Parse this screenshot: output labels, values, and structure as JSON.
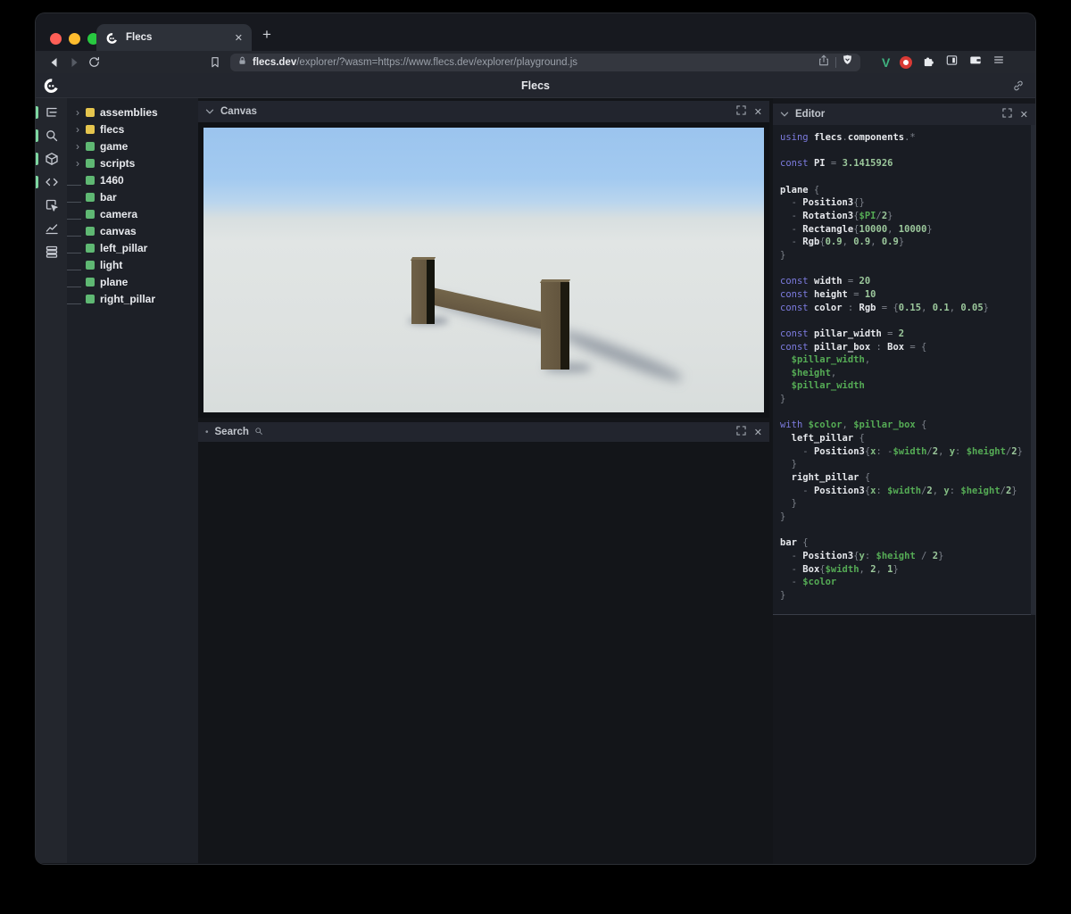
{
  "browser": {
    "tab": {
      "label": "Flecs"
    },
    "new_tab_label": "+",
    "url_domain": "flecs.dev",
    "url_path": "/explorer/?wasm=https://www.flecs.dev/explorer/playground.js"
  },
  "header": {
    "title": "Flecs"
  },
  "rail": {
    "items": [
      "tree-view",
      "search",
      "entities",
      "code",
      "inspect",
      "chart",
      "stats"
    ],
    "active": [
      "tree-view",
      "search",
      "entities",
      "code"
    ]
  },
  "tree": {
    "items": [
      {
        "label": "assemblies",
        "color": "yellow",
        "expandable": true
      },
      {
        "label": "flecs",
        "color": "yellow",
        "expandable": true
      },
      {
        "label": "game",
        "color": "green",
        "expandable": true
      },
      {
        "label": "scripts",
        "color": "green",
        "expandable": true
      },
      {
        "label": "1460",
        "color": "green",
        "expandable": false
      },
      {
        "label": "bar",
        "color": "green",
        "expandable": false
      },
      {
        "label": "camera",
        "color": "green",
        "expandable": false
      },
      {
        "label": "canvas",
        "color": "green",
        "expandable": false
      },
      {
        "label": "left_pillar",
        "color": "green",
        "expandable": false
      },
      {
        "label": "light",
        "color": "green",
        "expandable": false
      },
      {
        "label": "plane",
        "color": "green",
        "expandable": false
      },
      {
        "label": "right_pillar",
        "color": "green",
        "expandable": false
      }
    ]
  },
  "panels": {
    "canvas": {
      "title": "Canvas"
    },
    "search": {
      "title": "Search"
    },
    "editor": {
      "title": "Editor"
    }
  },
  "editor": {
    "code_lines": [
      [
        [
          "k",
          "using "
        ],
        [
          "i",
          "flecs"
        ],
        [
          "p",
          "."
        ],
        [
          "i",
          "components"
        ],
        [
          "p",
          ".*"
        ]
      ],
      [],
      [
        [
          "k",
          "const "
        ],
        [
          "i",
          "PI"
        ],
        [
          "p",
          " = "
        ],
        [
          "n",
          "3.1415926"
        ]
      ],
      [],
      [
        [
          "i",
          "plane"
        ],
        [
          "p",
          " {"
        ]
      ],
      [
        [
          "p",
          "  - "
        ],
        [
          "i",
          "Position3"
        ],
        [
          "p",
          "{}"
        ]
      ],
      [
        [
          "p",
          "  - "
        ],
        [
          "i",
          "Rotation3"
        ],
        [
          "p",
          "{"
        ],
        [
          "v",
          "$PI"
        ],
        [
          "p",
          "/"
        ],
        [
          "n",
          "2"
        ],
        [
          "p",
          "}"
        ]
      ],
      [
        [
          "p",
          "  - "
        ],
        [
          "i",
          "Rectangle"
        ],
        [
          "p",
          "{"
        ],
        [
          "n",
          "10000"
        ],
        [
          "p",
          ", "
        ],
        [
          "n",
          "10000"
        ],
        [
          "p",
          "}"
        ]
      ],
      [
        [
          "p",
          "  - "
        ],
        [
          "i",
          "Rgb"
        ],
        [
          "p",
          "{"
        ],
        [
          "n",
          "0.9"
        ],
        [
          "p",
          ", "
        ],
        [
          "n",
          "0.9"
        ],
        [
          "p",
          ", "
        ],
        [
          "n",
          "0.9"
        ],
        [
          "p",
          "}"
        ]
      ],
      [
        [
          "p",
          "}"
        ]
      ],
      [],
      [
        [
          "k",
          "const "
        ],
        [
          "i",
          "width"
        ],
        [
          "p",
          " = "
        ],
        [
          "n",
          "20"
        ]
      ],
      [
        [
          "k",
          "const "
        ],
        [
          "i",
          "height"
        ],
        [
          "p",
          " = "
        ],
        [
          "n",
          "10"
        ]
      ],
      [
        [
          "k",
          "const "
        ],
        [
          "i",
          "color"
        ],
        [
          "p",
          " : "
        ],
        [
          "i",
          "Rgb"
        ],
        [
          "p",
          " = {"
        ],
        [
          "n",
          "0.15"
        ],
        [
          "p",
          ", "
        ],
        [
          "n",
          "0.1"
        ],
        [
          "p",
          ", "
        ],
        [
          "n",
          "0.05"
        ],
        [
          "p",
          "}"
        ]
      ],
      [],
      [
        [
          "k",
          "const "
        ],
        [
          "i",
          "pillar_width"
        ],
        [
          "p",
          " = "
        ],
        [
          "n",
          "2"
        ]
      ],
      [
        [
          "k",
          "const "
        ],
        [
          "i",
          "pillar_box"
        ],
        [
          "p",
          " : "
        ],
        [
          "i",
          "Box"
        ],
        [
          "p",
          " = {"
        ]
      ],
      [
        [
          "v",
          "  $pillar_width"
        ],
        [
          "p",
          ","
        ]
      ],
      [
        [
          "v",
          "  $height"
        ],
        [
          "p",
          ","
        ]
      ],
      [
        [
          "v",
          "  $pillar_width"
        ]
      ],
      [
        [
          "p",
          "}"
        ]
      ],
      [],
      [
        [
          "k",
          "with "
        ],
        [
          "v",
          "$color"
        ],
        [
          "p",
          ", "
        ],
        [
          "v",
          "$pillar_box"
        ],
        [
          "p",
          " {"
        ]
      ],
      [
        [
          "i",
          "  left_pillar"
        ],
        [
          "p",
          " {"
        ]
      ],
      [
        [
          "p",
          "    - "
        ],
        [
          "i",
          "Position3"
        ],
        [
          "p",
          "{"
        ],
        [
          "key",
          "x"
        ],
        [
          "p",
          ": -"
        ],
        [
          "v",
          "$width"
        ],
        [
          "p",
          "/"
        ],
        [
          "n",
          "2"
        ],
        [
          "p",
          ", "
        ],
        [
          "key",
          "y"
        ],
        [
          "p",
          ": "
        ],
        [
          "v",
          "$height"
        ],
        [
          "p",
          "/"
        ],
        [
          "n",
          "2"
        ],
        [
          "p",
          "}"
        ]
      ],
      [
        [
          "p",
          "  }"
        ]
      ],
      [
        [
          "i",
          "  right_pillar"
        ],
        [
          "p",
          " {"
        ]
      ],
      [
        [
          "p",
          "    - "
        ],
        [
          "i",
          "Position3"
        ],
        [
          "p",
          "{"
        ],
        [
          "key",
          "x"
        ],
        [
          "p",
          ": "
        ],
        [
          "v",
          "$width"
        ],
        [
          "p",
          "/"
        ],
        [
          "n",
          "2"
        ],
        [
          "p",
          ", "
        ],
        [
          "key",
          "y"
        ],
        [
          "p",
          ": "
        ],
        [
          "v",
          "$height"
        ],
        [
          "p",
          "/"
        ],
        [
          "n",
          "2"
        ],
        [
          "p",
          "}"
        ]
      ],
      [
        [
          "p",
          "  }"
        ]
      ],
      [
        [
          "p",
          "}"
        ]
      ],
      [],
      [
        [
          "i",
          "bar"
        ],
        [
          "p",
          " {"
        ]
      ],
      [
        [
          "p",
          "  - "
        ],
        [
          "i",
          "Position3"
        ],
        [
          "p",
          "{"
        ],
        [
          "key",
          "y"
        ],
        [
          "p",
          ": "
        ],
        [
          "v",
          "$height"
        ],
        [
          "p",
          " / "
        ],
        [
          "n",
          "2"
        ],
        [
          "p",
          "}"
        ]
      ],
      [
        [
          "p",
          "  - "
        ],
        [
          "i",
          "Box"
        ],
        [
          "p",
          "{"
        ],
        [
          "v",
          "$width"
        ],
        [
          "p",
          ", "
        ],
        [
          "n",
          "2"
        ],
        [
          "p",
          ", "
        ],
        [
          "n",
          "1"
        ],
        [
          "p",
          "}"
        ]
      ],
      [
        [
          "p",
          "  - "
        ],
        [
          "v",
          "$color"
        ]
      ],
      [
        [
          "p",
          "}"
        ]
      ]
    ]
  },
  "icons": {
    "close": "✕",
    "chevron_right": "›",
    "bullet": "•"
  },
  "colors": {
    "entity_green": "#5fb873",
    "entity_yellow": "#e5c54e",
    "keyword": "#7d7ce0",
    "identifier": "#e6e8ec",
    "punctuation": "#7b8089",
    "number": "#9cc89c",
    "variable": "#55ab55",
    "sky": "#9ec7ef",
    "ground": "#e0e4e3",
    "wood": "#6b5d43",
    "wood_dark": "#17160f",
    "traffic_red": "#ff5f57",
    "traffic_yellow": "#febc2e",
    "traffic_green": "#28c840"
  }
}
